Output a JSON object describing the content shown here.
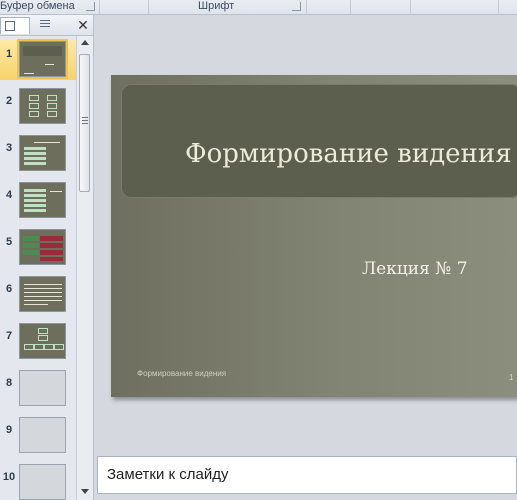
{
  "ribbon": {
    "groups": [
      "Буфер обмена",
      "Шрифт"
    ]
  },
  "slides_pane": {
    "close_label": "✕",
    "thumbnails": [
      {
        "num": "1",
        "kind": "title",
        "selected": true
      },
      {
        "num": "2",
        "kind": "diagram"
      },
      {
        "num": "3",
        "kind": "list"
      },
      {
        "num": "4",
        "kind": "list"
      },
      {
        "num": "5",
        "kind": "table"
      },
      {
        "num": "6",
        "kind": "text"
      },
      {
        "num": "7",
        "kind": "hierarchy"
      },
      {
        "num": "8",
        "kind": "blank"
      },
      {
        "num": "9",
        "kind": "blank"
      },
      {
        "num": "10",
        "kind": "blank"
      }
    ]
  },
  "slide": {
    "title": "Формирование видения",
    "subtitle": "Лекция № 7",
    "footer": "Формирование видения",
    "number": "1"
  },
  "notes": {
    "placeholder": "Заметки к слайду"
  },
  "colors": {
    "slide_background": "#7d7f6e",
    "title_box": "#5c5e4e",
    "selection": "#f7d36b"
  }
}
